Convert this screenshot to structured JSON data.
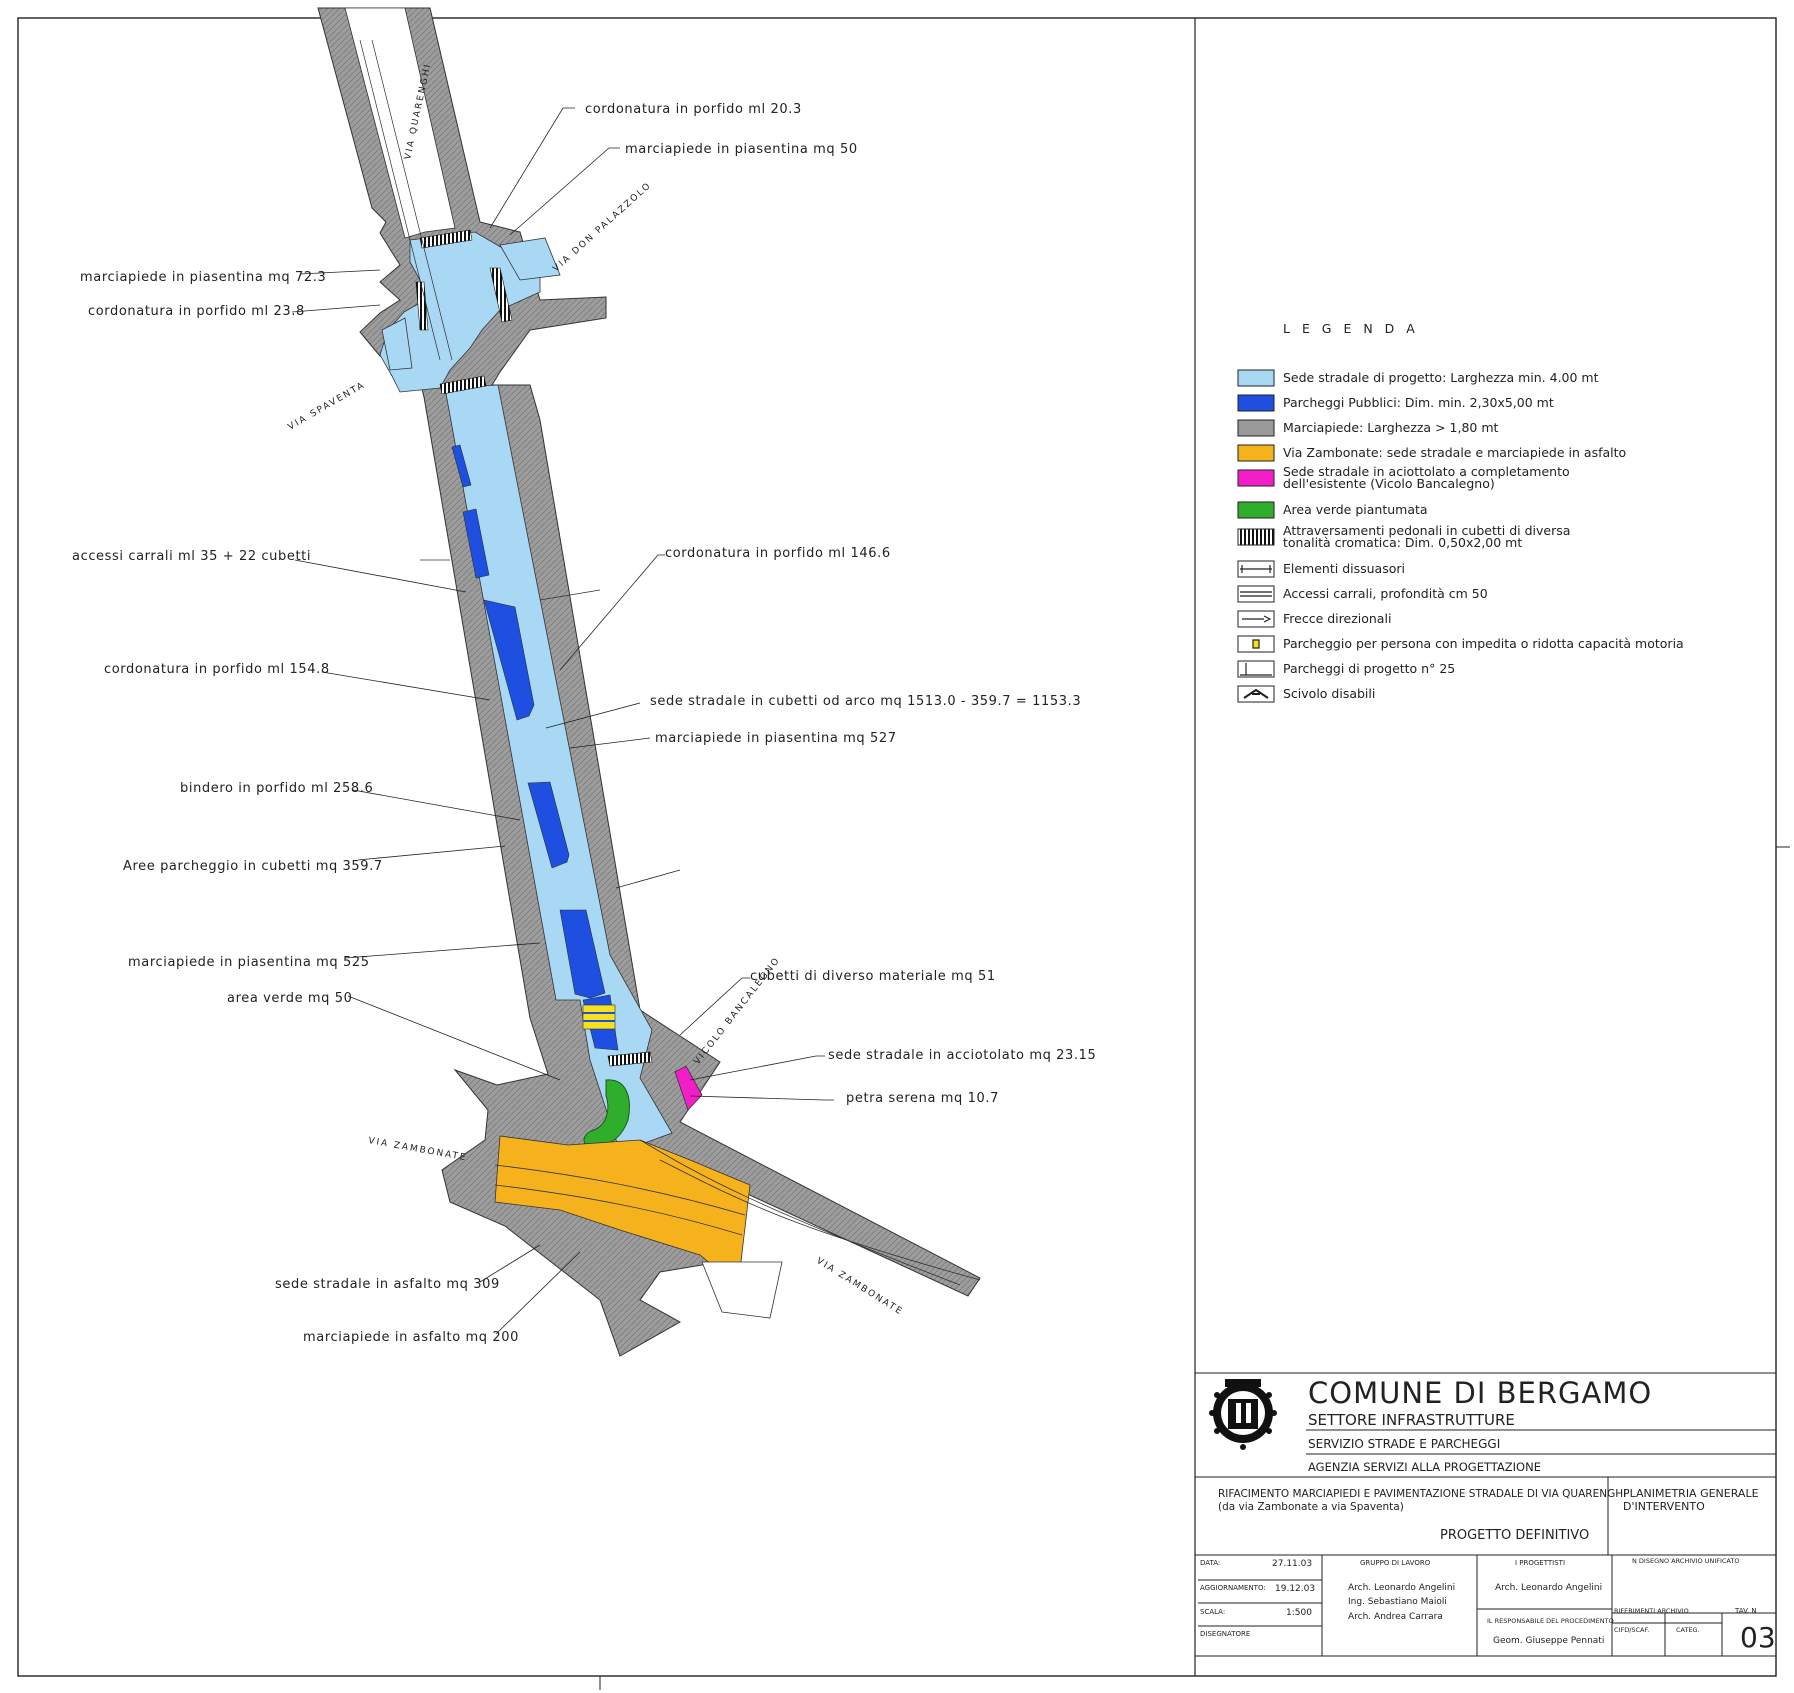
{
  "annotations": {
    "a1": "cordonatura in porfido ml 20.3",
    "a2": "marciapiede in piasentina mq 50",
    "a3": "marciapiede in piasentina mq 72.3",
    "a4": "cordonatura in porfido ml 23.8",
    "a5": "accessi carrali ml 35 + 22 cubetti",
    "a6": "cordonatura in porfido ml 146.6",
    "a7": "cordonatura in porfido ml 154.8",
    "a8": "sede stradale in   cubetti od arco mq 1513.0 - 359.7 = 1153.3",
    "a9": "marciapiede in piasentina mq 527",
    "a10": "bindero in porfido ml 258.6",
    "a11": "Aree parcheggio in cubetti mq 359.7",
    "a12": "marciapiede in piasentina mq 525",
    "a13": "cubetti di diverso materiale mq 51",
    "a14": "area verde mq 50",
    "a15": "sede stradale in acciotolato mq 23.15",
    "a16": "petra serena mq 10.7",
    "a17": "sede stradale in asfalto mq 309",
    "a18": "marciapiede in asfalto mq 200"
  },
  "streets": {
    "quarenghi": "VIA QUARENGHI",
    "palazzolo": "VIA DON PALAZZOLO",
    "spaventa": "VIA SPAVENTA",
    "zambonate1": "VIA ZAMBONATE",
    "zambonate2": "VIA ZAMBONATE",
    "bancalegno": "VICOLO BANCALEGNO"
  },
  "legend": {
    "title": "L E G E N D A",
    "items": [
      {
        "text": "Sede stradale di progetto: Larghezza min. 4.00 mt",
        "text2": "",
        "color": "#a9d8f5"
      },
      {
        "text": "Parcheggi Pubblici: Dim. min. 2,30x5,00 mt",
        "text2": "",
        "color": "#1f4fe0"
      },
      {
        "text": "Marciapiede: Larghezza > 1,80 mt",
        "text2": "",
        "color": "#9a9a9a"
      },
      {
        "text": "Via Zambonate: sede stradale e marciapiede in asfalto",
        "text2": "",
        "color": "#f6b21c"
      },
      {
        "text": "Sede stradale in aciottolato a completamento",
        "text2": "dell'esistente (Vicolo Bancalegno)",
        "color": "#f21ec8"
      },
      {
        "text": "Area verde piantumata",
        "text2": "",
        "color": "#2fae2c"
      },
      {
        "text": "Attraversamenti pedonali in cubetti di  diversa",
        "text2": "tonalità cromatica: Dim. 0,50x2,00 mt",
        "color": "#111111"
      },
      {
        "text": "Elementi dissuasori",
        "text2": "",
        "color": "#ffffff"
      },
      {
        "text": "Accessi carrali, profondità cm 50",
        "text2": "",
        "color": "#ffffff"
      },
      {
        "text": "Frecce direzionali",
        "text2": "",
        "color": "#ffffff"
      },
      {
        "text": "Parcheggio per persona con impedita o ridotta capacità motoria",
        "text2": "",
        "color": "#ffffff"
      },
      {
        "text": "Parcheggi di progetto n° 25",
        "text2": "",
        "color": "#ffffff"
      },
      {
        "text": "Scivolo disabili",
        "text2": "",
        "color": "#ffffff"
      }
    ]
  },
  "titleblock": {
    "comune": "COMUNE DI BERGAMO",
    "settore": "SETTORE INFRASTRUTTURE",
    "servizio": "SERVIZIO STRADE E PARCHEGGI",
    "agenzia": "AGENZIA SERVIZI ALLA PROGETTAZIONE",
    "project1": "RIFACIMENTO MARCIAPIEDI E PAVIMENTAZIONE STRADALE DI VIA QUARENGHI",
    "project2": "(da via Zambonate a via Spaventa)",
    "phase": "PROGETTO DEFINITIVO",
    "sheet1": "PLANIMETRIA GENERALE",
    "sheet2": "D'INTERVENTO",
    "data_label": "DATA:",
    "data_value": "27.11.03",
    "agg_label": "AGGIORNAMENTO:",
    "agg_value": "19.12.03",
    "scala_label": "SCALA:",
    "scala_value": "1:500",
    "disegnatore_label": "DISEGNATORE",
    "gruppo_label": "GRUPPO DI LAVORO",
    "gruppo1": "Arch. Leonardo Angelini",
    "gruppo2": "Ing.  Sebastiano Maioli",
    "gruppo3": "Arch. Andrea Carrara",
    "progettisti_label": "I PROGETTISTI",
    "progettisti1": "Arch. Leonardo Angelini",
    "resp_label": "IL RESPONSABILE DEL PROCEDIMENTO",
    "resp_name": "Geom. Giuseppe Pennati",
    "archivio_label": "N DISEGNO ARCHIVIO UNIFICATO",
    "rif_label": "RIFERIMENTI ARCHIVIO",
    "tav_label": "TAV.  N",
    "cifd_label": "CIFD/SCAF.",
    "categ_label": "CATEG.",
    "tav_number": "03"
  },
  "colors": {
    "road": "#a9d8f5",
    "parking": "#1f4fe0",
    "sidewalk": "#9a9a9a",
    "asphalt": "#f6b21c",
    "cobble": "#f21ec8",
    "green": "#2fae2c"
  }
}
